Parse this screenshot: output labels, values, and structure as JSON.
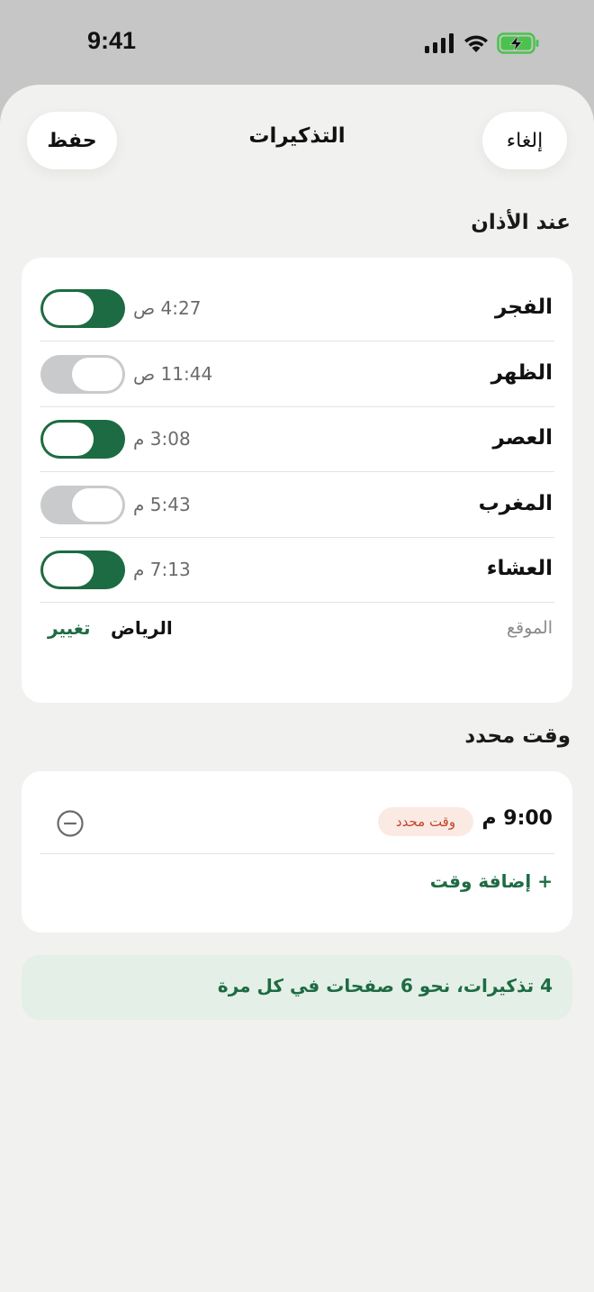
{
  "status_bar": {
    "time": "9:41",
    "icons": [
      "signal-icon",
      "wifi-icon",
      "battery-charging-icon"
    ]
  },
  "header": {
    "title": "التذكيرات",
    "cancel_label": "إلغاء",
    "save_label": "حفظ"
  },
  "adhan_section": {
    "title": "عند الأذان",
    "prayers": [
      {
        "name": "الفجر",
        "time": "4:27 ص",
        "enabled": true
      },
      {
        "name": "الظهر",
        "time": "11:44 ص",
        "enabled": false
      },
      {
        "name": "العصر",
        "time": "3:08 م",
        "enabled": true
      },
      {
        "name": "المغرب",
        "time": "5:43 م",
        "enabled": false
      },
      {
        "name": "العشاء",
        "time": "7:13 م",
        "enabled": true
      }
    ],
    "location_label": "الموقع",
    "location_city": "الرياض",
    "change_label": "تغيير"
  },
  "custom_section": {
    "title": "وقت محدد",
    "time": "9:00 م",
    "badge": "وقت محدد",
    "add_label": "+ إضافة وقت"
  },
  "summary": {
    "text": "4 تذكيرات، نحو 6 صفحات في كل مرة"
  },
  "colors": {
    "accent": "#1d6b42",
    "toggle_off": "#c9cacc",
    "badge_bg": "#fbe9e3",
    "badge_text": "#c0462a",
    "summary_bg": "#e3efe7"
  }
}
